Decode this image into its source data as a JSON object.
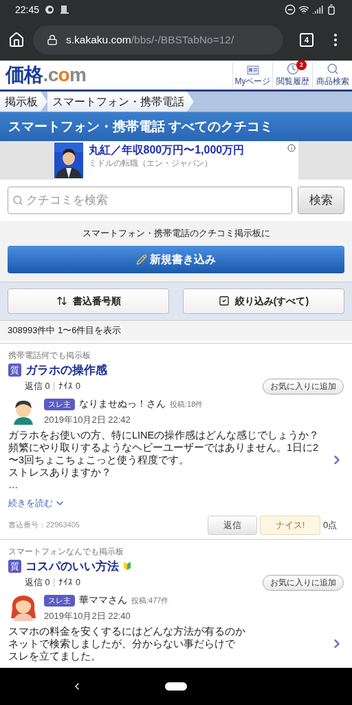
{
  "status_bar": {
    "time": "22:45"
  },
  "browser": {
    "url_host": "s.kakaku.com",
    "url_path": "/bbs/-/BBSTabNo=12/",
    "tab_count": "4"
  },
  "site_header": {
    "logo": [
      {
        "text": "価格",
        "color": "#1a3d96"
      },
      {
        "text": ".c",
        "color": "#8a8a8a"
      },
      {
        "text": "o",
        "color": "#f07a12"
      },
      {
        "text": "m",
        "color": "#8a8a8a"
      }
    ],
    "nav": [
      {
        "label": "Myページ",
        "kind": "page"
      },
      {
        "label": "閲覧履歴",
        "kind": "history",
        "badge": "2"
      },
      {
        "label": "商品検索",
        "kind": "search"
      }
    ]
  },
  "breadcrumbs": [
    "掲示板",
    "スマートフォン・携帯電話"
  ],
  "page_title": "スマートフォン・携帯電話 すべてのクチコミ",
  "ad": {
    "kind": "picture",
    "headline": "丸紅／年収800万円〜1,000万円",
    "sub": "ミドルの転職（エン・ジャパン）"
  },
  "search": {
    "placeholder": "クチコミを検索",
    "button": "検索"
  },
  "new_post": {
    "caption": "スマートフォン・携帯電話のクチコミ掲示板に",
    "button": "新規書き込み"
  },
  "tools": [
    {
      "label": "書込番号順",
      "kind": "sort"
    },
    {
      "label": "絞り込み(すべて)",
      "kind": "filter"
    }
  ],
  "result_count": "308993件中 1〜6件目を表示",
  "posts": [
    {
      "board": "携帯電話何でも掲示板",
      "tag": "質",
      "title": "ガラホの操作感",
      "beginner": false,
      "replies": "返信 0",
      "nice": "ﾅｲｽ 0",
      "favorite": "お気に入りに追加",
      "avatar": {
        "kind": "male"
      },
      "role": "スレ主",
      "author": "なりませぬっ！さん",
      "post_count": "投稿:18件",
      "date": "2019年10月2日 22:42",
      "body": [
        "ガラホをお使いの方、特にLINEの操作感はどんな感じでしょうか？",
        "頻繁にやり取りするようなヘビーユーザーではありません。1日に2",
        "〜3回ちょこちょこっと使う程度です。",
        "ストレスありますか？",
        "…"
      ],
      "read_more": "続きを読む",
      "post_number": "書込番号：22963405",
      "reply_button": "返信",
      "nice_button": "ナイス!",
      "points": "0点"
    },
    {
      "board": "スマートフォンなんでも掲示板",
      "tag": "質",
      "title": "コスパのいい方法",
      "beginner": true,
      "replies": "返信 0",
      "nice": "ﾅｲｽ 0",
      "favorite": "お気に入りに追加",
      "avatar": {
        "kind": "female"
      },
      "role": "スレ主",
      "author": "華ママさん",
      "post_count": "投稿:477件",
      "date": "2019年10月2日 22:40",
      "body": [
        "スマホの料金を安くするにはどんな方法が有るのか",
        "ネットで検索しましたが、分からない事だらけで",
        "スレを立てました。"
      ]
    }
  ]
}
